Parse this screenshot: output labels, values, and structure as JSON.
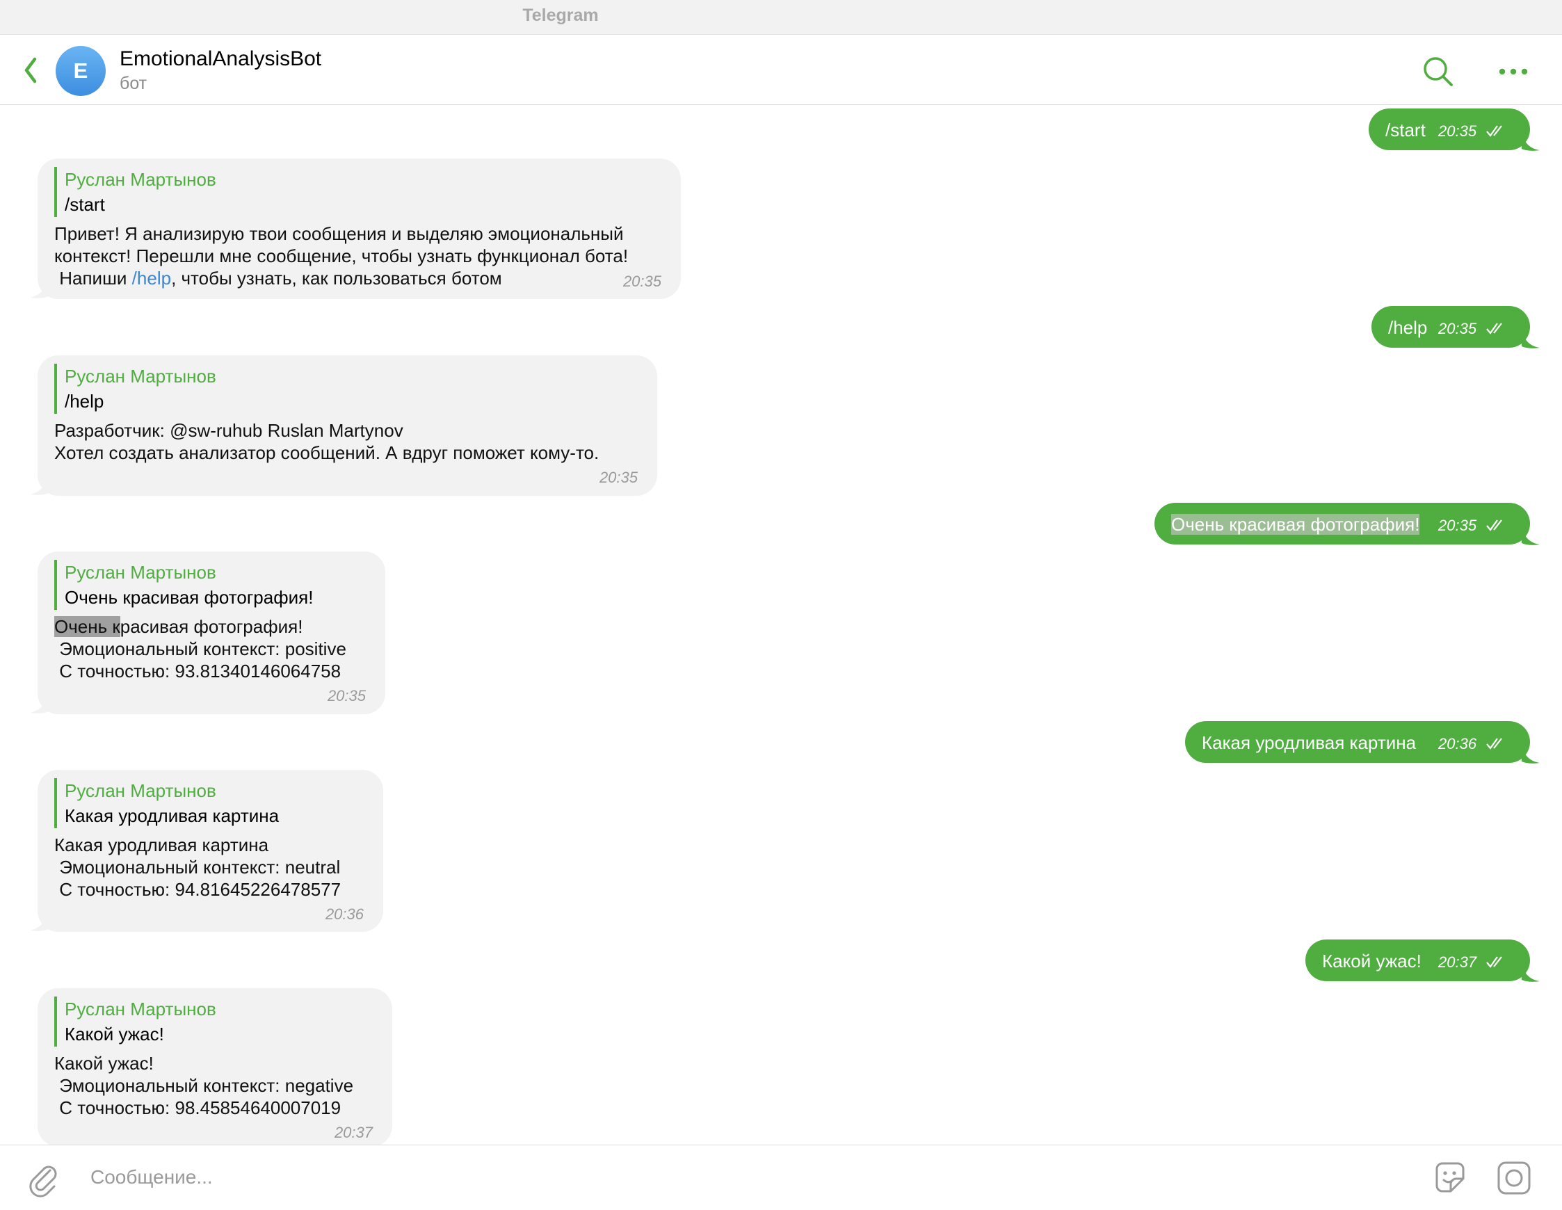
{
  "window": {
    "title": "Telegram"
  },
  "header": {
    "avatar_letter": "E",
    "name": "EmotionalAnalysisBot",
    "status": "бот",
    "icons": [
      "back-icon",
      "search-icon",
      "more-icon"
    ]
  },
  "colors": {
    "accent": "#4fae3f",
    "incoming_bg": "#f2f2f3",
    "link": "#3c86d6",
    "avatar": "#4a9ae6"
  },
  "messages": [
    {
      "dir": "out",
      "text": "/start",
      "time": "20:35"
    },
    {
      "dir": "in",
      "quote_author": "Руслан Мартынов",
      "quote_text": "/start",
      "line1": "Привет! Я анализирую твои сообщения и выделяю эмоциональный",
      "line2": "контекст! Перешли мне сообщение, чтобы узнать функционал бота!",
      "line3_pre": " Напиши ",
      "line3_link": "/help",
      "line3_post": ", чтобы узнать, как пользоваться ботом",
      "time": "20:35"
    },
    {
      "dir": "out",
      "text": "/help",
      "time": "20:35"
    },
    {
      "dir": "in",
      "quote_author": "Руслан Мартынов",
      "quote_text": "/help",
      "line1": "Разработчик: @sw-ruhub Ruslan Martynov",
      "line2": "Хотел создать анализатор сообщений. А вдруг поможет кому-то.",
      "time": "20:35"
    },
    {
      "dir": "out",
      "text": "Очень красивая фотография!",
      "time": "20:35"
    },
    {
      "dir": "in",
      "quote_author": "Руслан Мартынов",
      "quote_text": "Очень красивая фотография!",
      "line1_hl": "Очень к",
      "line1_rest": "расивая фотография!",
      "line2": " Эмоциональный контекст: positive",
      "line3": " С точностью: 93.81340146064758",
      "time": "20:35"
    },
    {
      "dir": "out",
      "text": "Какая уродливая картина",
      "time": "20:36"
    },
    {
      "dir": "in",
      "quote_author": "Руслан Мартынов",
      "quote_text": "Какая уродливая картина",
      "line1": "Какая уродливая картина",
      "line2": " Эмоциональный контекст: neutral",
      "line3": " С точностью: 94.81645226478577",
      "time": "20:36"
    },
    {
      "dir": "out",
      "text": "Какой ужас!",
      "time": "20:37"
    },
    {
      "dir": "in",
      "quote_author": "Руслан Мартынов",
      "quote_text": "Какой ужас!",
      "line1": "Какой ужас!",
      "line2": " Эмоциональный контекст: negative",
      "line3": " С точностью: 98.45854640007019",
      "time": "20:37"
    }
  ],
  "composer": {
    "placeholder": "Сообщение...",
    "value": "",
    "icons": [
      "attach-icon",
      "sticker-icon",
      "camera-icon"
    ]
  }
}
